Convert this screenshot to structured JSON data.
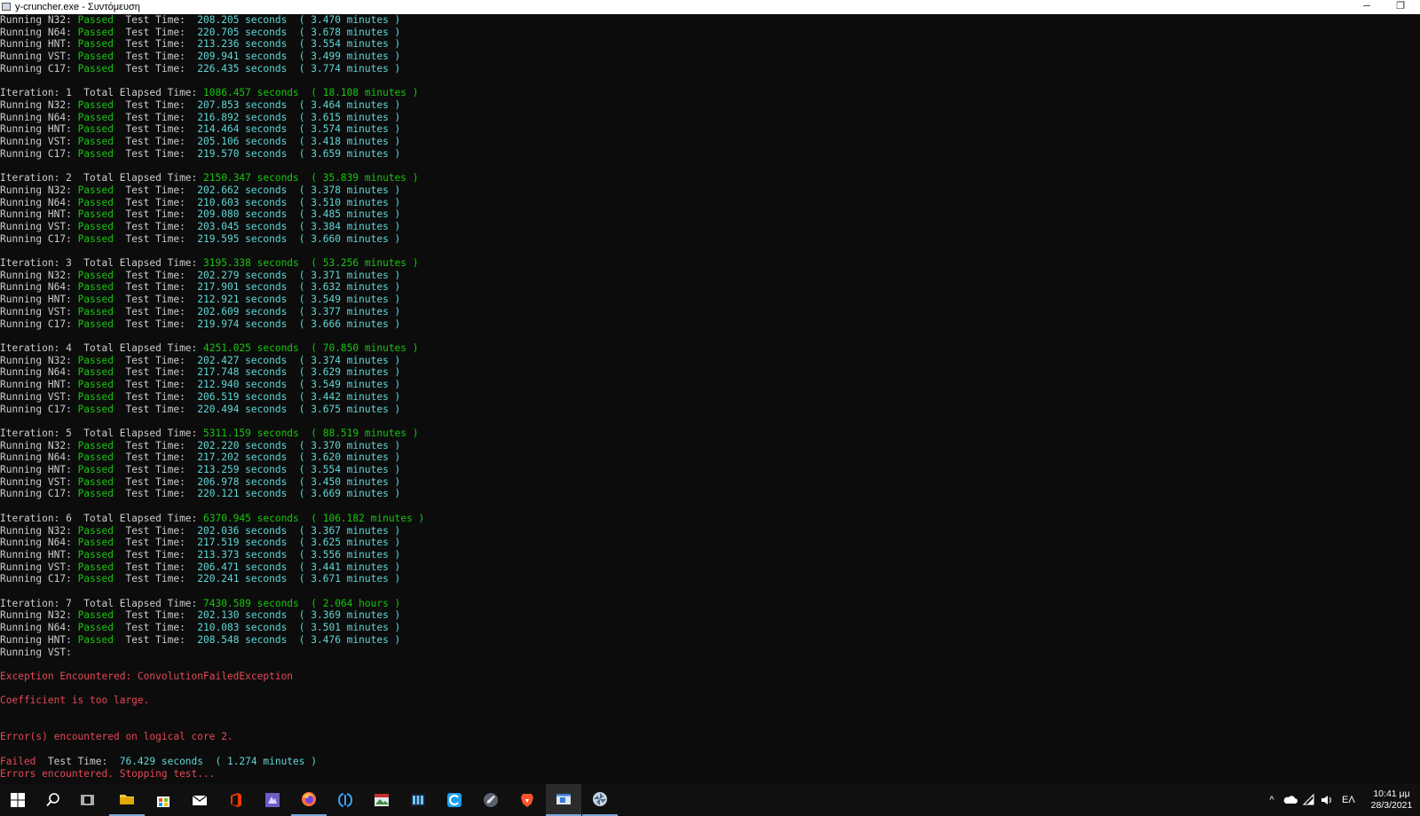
{
  "window": {
    "title": "y-cruncher.exe - Συντόμευση",
    "minimize_glyph": "─",
    "restore_glyph": "❐"
  },
  "console": {
    "pre_iteration": [
      {
        "test": "N32",
        "status": "Passed",
        "seconds": "208.205",
        "duration": "3.470",
        "unit": "minutes"
      },
      {
        "test": "N64",
        "status": "Passed",
        "seconds": "220.705",
        "duration": "3.678",
        "unit": "minutes"
      },
      {
        "test": "HNT",
        "status": "Passed",
        "seconds": "213.236",
        "duration": "3.554",
        "unit": "minutes"
      },
      {
        "test": "VST",
        "status": "Passed",
        "seconds": "209.941",
        "duration": "3.499",
        "unit": "minutes"
      },
      {
        "test": "C17",
        "status": "Passed",
        "seconds": "226.435",
        "duration": "3.774",
        "unit": "minutes"
      }
    ],
    "iterations": [
      {
        "number": "1",
        "elapsed_seconds": "1086.457",
        "elapsed": "18.108",
        "elapsed_unit": "minutes",
        "tests": [
          {
            "test": "N32",
            "status": "Passed",
            "seconds": "207.853",
            "duration": "3.464",
            "unit": "minutes"
          },
          {
            "test": "N64",
            "status": "Passed",
            "seconds": "216.892",
            "duration": "3.615",
            "unit": "minutes"
          },
          {
            "test": "HNT",
            "status": "Passed",
            "seconds": "214.464",
            "duration": "3.574",
            "unit": "minutes"
          },
          {
            "test": "VST",
            "status": "Passed",
            "seconds": "205.106",
            "duration": "3.418",
            "unit": "minutes"
          },
          {
            "test": "C17",
            "status": "Passed",
            "seconds": "219.570",
            "duration": "3.659",
            "unit": "minutes"
          }
        ]
      },
      {
        "number": "2",
        "elapsed_seconds": "2150.347",
        "elapsed": "35.839",
        "elapsed_unit": "minutes",
        "tests": [
          {
            "test": "N32",
            "status": "Passed",
            "seconds": "202.662",
            "duration": "3.378",
            "unit": "minutes"
          },
          {
            "test": "N64",
            "status": "Passed",
            "seconds": "210.603",
            "duration": "3.510",
            "unit": "minutes"
          },
          {
            "test": "HNT",
            "status": "Passed",
            "seconds": "209.080",
            "duration": "3.485",
            "unit": "minutes"
          },
          {
            "test": "VST",
            "status": "Passed",
            "seconds": "203.045",
            "duration": "3.384",
            "unit": "minutes"
          },
          {
            "test": "C17",
            "status": "Passed",
            "seconds": "219.595",
            "duration": "3.660",
            "unit": "minutes"
          }
        ]
      },
      {
        "number": "3",
        "elapsed_seconds": "3195.338",
        "elapsed": "53.256",
        "elapsed_unit": "minutes",
        "tests": [
          {
            "test": "N32",
            "status": "Passed",
            "seconds": "202.279",
            "duration": "3.371",
            "unit": "minutes"
          },
          {
            "test": "N64",
            "status": "Passed",
            "seconds": "217.901",
            "duration": "3.632",
            "unit": "minutes"
          },
          {
            "test": "HNT",
            "status": "Passed",
            "seconds": "212.921",
            "duration": "3.549",
            "unit": "minutes"
          },
          {
            "test": "VST",
            "status": "Passed",
            "seconds": "202.609",
            "duration": "3.377",
            "unit": "minutes"
          },
          {
            "test": "C17",
            "status": "Passed",
            "seconds": "219.974",
            "duration": "3.666",
            "unit": "minutes"
          }
        ]
      },
      {
        "number": "4",
        "elapsed_seconds": "4251.025",
        "elapsed": "70.850",
        "elapsed_unit": "minutes",
        "tests": [
          {
            "test": "N32",
            "status": "Passed",
            "seconds": "202.427",
            "duration": "3.374",
            "unit": "minutes"
          },
          {
            "test": "N64",
            "status": "Passed",
            "seconds": "217.748",
            "duration": "3.629",
            "unit": "minutes"
          },
          {
            "test": "HNT",
            "status": "Passed",
            "seconds": "212.940",
            "duration": "3.549",
            "unit": "minutes"
          },
          {
            "test": "VST",
            "status": "Passed",
            "seconds": "206.519",
            "duration": "3.442",
            "unit": "minutes"
          },
          {
            "test": "C17",
            "status": "Passed",
            "seconds": "220.494",
            "duration": "3.675",
            "unit": "minutes"
          }
        ]
      },
      {
        "number": "5",
        "elapsed_seconds": "5311.159",
        "elapsed": "88.519",
        "elapsed_unit": "minutes",
        "tests": [
          {
            "test": "N32",
            "status": "Passed",
            "seconds": "202.220",
            "duration": "3.370",
            "unit": "minutes"
          },
          {
            "test": "N64",
            "status": "Passed",
            "seconds": "217.202",
            "duration": "3.620",
            "unit": "minutes"
          },
          {
            "test": "HNT",
            "status": "Passed",
            "seconds": "213.259",
            "duration": "3.554",
            "unit": "minutes"
          },
          {
            "test": "VST",
            "status": "Passed",
            "seconds": "206.978",
            "duration": "3.450",
            "unit": "minutes"
          },
          {
            "test": "C17",
            "status": "Passed",
            "seconds": "220.121",
            "duration": "3.669",
            "unit": "minutes"
          }
        ]
      },
      {
        "number": "6",
        "elapsed_seconds": "6370.945",
        "elapsed": "106.182",
        "elapsed_unit": "minutes",
        "tests": [
          {
            "test": "N32",
            "status": "Passed",
            "seconds": "202.036",
            "duration": "3.367",
            "unit": "minutes"
          },
          {
            "test": "N64",
            "status": "Passed",
            "seconds": "217.519",
            "duration": "3.625",
            "unit": "minutes"
          },
          {
            "test": "HNT",
            "status": "Passed",
            "seconds": "213.373",
            "duration": "3.556",
            "unit": "minutes"
          },
          {
            "test": "VST",
            "status": "Passed",
            "seconds": "206.471",
            "duration": "3.441",
            "unit": "minutes"
          },
          {
            "test": "C17",
            "status": "Passed",
            "seconds": "220.241",
            "duration": "3.671",
            "unit": "minutes"
          }
        ]
      },
      {
        "number": "7",
        "elapsed_seconds": "7430.589",
        "elapsed": "2.064",
        "elapsed_unit": "hours",
        "tests": [
          {
            "test": "N32",
            "status": "Passed",
            "seconds": "202.130",
            "duration": "3.369",
            "unit": "minutes"
          },
          {
            "test": "N64",
            "status": "Passed",
            "seconds": "210.083",
            "duration": "3.501",
            "unit": "minutes"
          },
          {
            "test": "HNT",
            "status": "Passed",
            "seconds": "208.548",
            "duration": "3.476",
            "unit": "minutes"
          }
        ],
        "running_incomplete": "VST"
      }
    ],
    "exception_line": "Exception Encountered: ConvolutionFailedException",
    "coefficient_line": "Coefficient is too large.",
    "core_error_line": "Error(s) encountered on logical core 2.",
    "failed": {
      "status": "Failed",
      "seconds": "76.429",
      "duration": "1.274",
      "unit": "minutes"
    },
    "stopping_line": "Errors encountered. Stopping test..."
  },
  "taskbar": {
    "items": [
      {
        "name": "start-button",
        "icon": "windows-logo-icon"
      },
      {
        "name": "search-button",
        "icon": "search-icon"
      },
      {
        "name": "task-view-button",
        "icon": "task-view-icon"
      },
      {
        "name": "file-explorer-button",
        "icon": "folder-icon"
      },
      {
        "name": "store-button",
        "icon": "store-icon"
      },
      {
        "name": "mail-button",
        "icon": "mail-icon"
      },
      {
        "name": "office-button",
        "icon": "office-icon"
      },
      {
        "name": "app-purple-button",
        "icon": "app-purple-icon"
      },
      {
        "name": "firefox-button",
        "icon": "firefox-icon"
      },
      {
        "name": "app-blue-bracket-button",
        "icon": "bracket-app-icon"
      },
      {
        "name": "photos-button",
        "icon": "photos-icon"
      },
      {
        "name": "app-grid-button",
        "icon": "grid-app-icon"
      },
      {
        "name": "ccleaner-button",
        "icon": "ccleaner-icon"
      },
      {
        "name": "app-rocket-button",
        "icon": "rocket-icon"
      },
      {
        "name": "brave-button",
        "icon": "brave-lion-icon"
      },
      {
        "name": "y-cruncher-console-button",
        "icon": "console-window-icon"
      },
      {
        "name": "app-pinwheel-button",
        "icon": "pinwheel-icon"
      }
    ],
    "tray": {
      "chevron": "^",
      "language": "ΕΛ",
      "time": "10:41 μμ",
      "date": "28/3/2021"
    }
  },
  "colors": {
    "console_bg": "#0c0c0c",
    "text_default": "#cccccc",
    "passed_green": "#16c60c",
    "value_cyan": "#61d6d6",
    "error_red": "#e74856",
    "taskbar_bg": "#101010"
  }
}
